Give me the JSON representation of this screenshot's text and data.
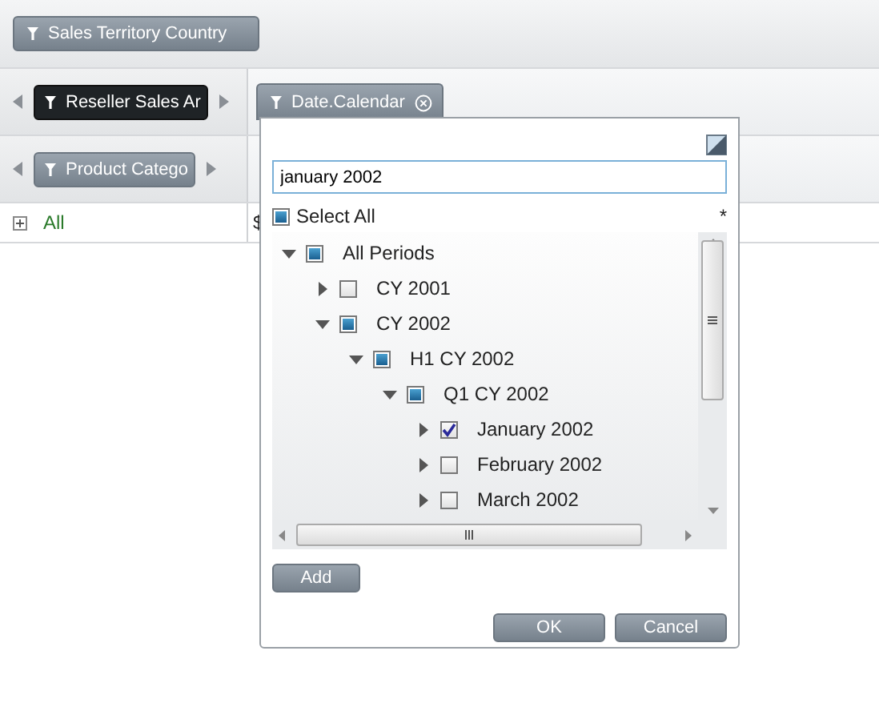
{
  "filter_bar": {
    "button": "Sales Territory Country"
  },
  "row_fields": [
    {
      "label": "Reseller Sales Ar",
      "selected": true
    },
    {
      "label": "Product Catego",
      "selected": false
    }
  ],
  "grid": {
    "row_label": "All",
    "column_2": "$"
  },
  "column_field": {
    "label": "Date.Calendar"
  },
  "popup": {
    "search_value": "january 2002",
    "select_all": {
      "label": "Select All",
      "checked": false,
      "partial": true
    },
    "asterisk": "*",
    "tree": [
      {
        "label": "All Periods",
        "expanded": true,
        "checked": false,
        "partial": true,
        "children": [
          {
            "label": "CY 2001",
            "expanded": false,
            "checked": false,
            "partial": false
          },
          {
            "label": "CY 2002",
            "expanded": true,
            "checked": false,
            "partial": true,
            "children": [
              {
                "label": "H1 CY 2002",
                "expanded": true,
                "checked": false,
                "partial": true,
                "children": [
                  {
                    "label": "Q1 CY 2002",
                    "expanded": true,
                    "checked": false,
                    "partial": true,
                    "children": [
                      {
                        "label": "January 2002",
                        "expanded": false,
                        "checked": true,
                        "partial": false
                      },
                      {
                        "label": "February 2002",
                        "expanded": false,
                        "checked": false,
                        "partial": false
                      },
                      {
                        "label": "March 2002",
                        "expanded": false,
                        "checked": false,
                        "partial": false
                      }
                    ]
                  }
                ]
              }
            ]
          }
        ]
      }
    ],
    "add_button": "Add",
    "buttons": [
      "OK",
      "Cancel"
    ]
  }
}
